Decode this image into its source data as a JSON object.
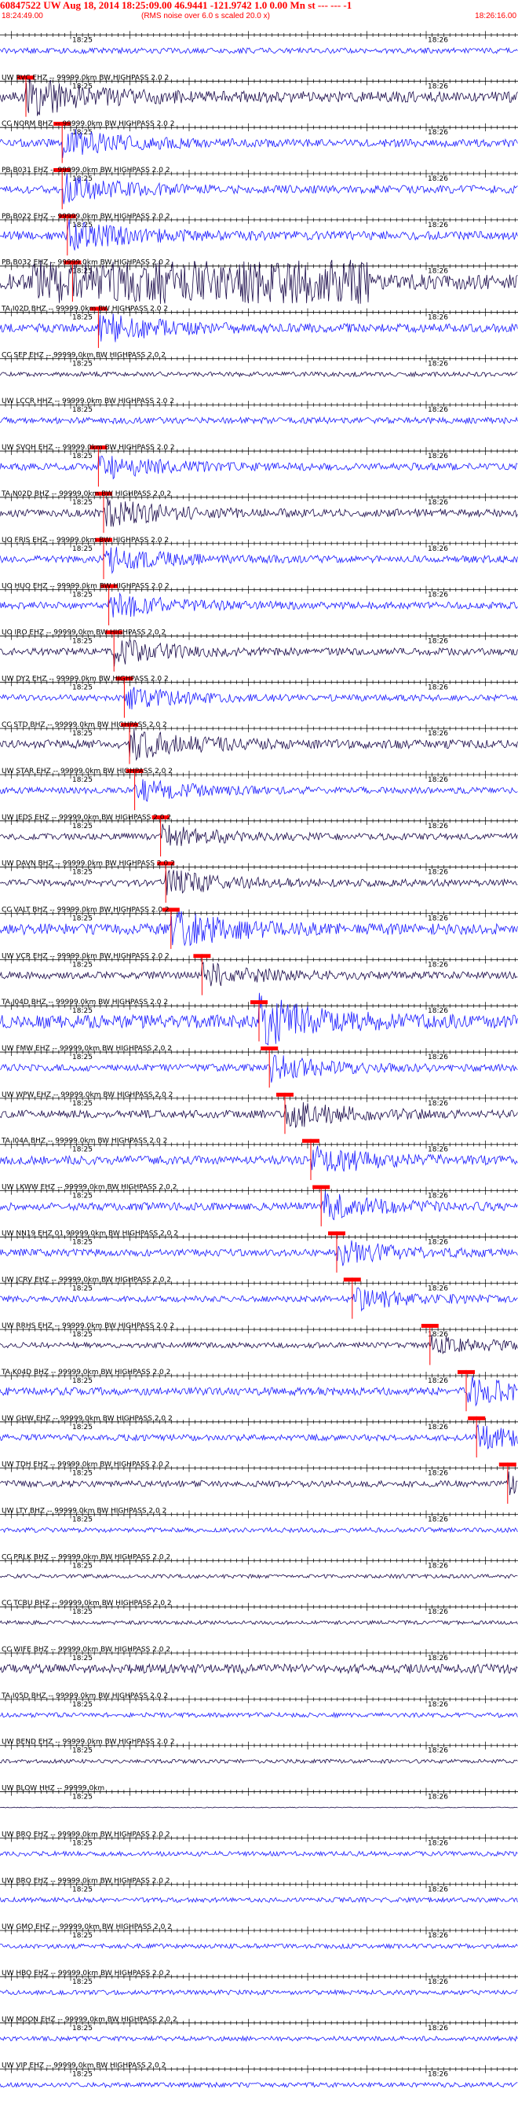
{
  "header": {
    "title": "60847522 UW Aug 18, 2014 18:25:09.00   46.9441 -121.9742  1.0 0.00 Mn st --- --- -1",
    "start_time": "18:24:49.00",
    "note": "(RMS noise over 6.0 s scaled 20.0 x)",
    "end_time": "18:26:16.00"
  },
  "colors": {
    "blue_trace": "#1a1aff",
    "dark_trace": "#1a0a4a",
    "pick_marker": "#ff0000",
    "grid_line": "#000000",
    "header_text": "#ff0000"
  },
  "chart_data": {
    "type": "line",
    "title": "60847522 UW Aug 18, 2014 18:25:09.00   46.9441 -121.9742  1.0 0.00 Mn st --- --- -1",
    "x_range": [
      "18:24:49.00",
      "18:26:16.00"
    ],
    "time_tick_labels": [
      "18:25",
      "18:26"
    ],
    "traces": [
      {
        "label": "",
        "color": "blue",
        "amplitude": 0.35,
        "pick": null
      },
      {
        "label": "UW RVC EHZ -- 99999.0km BW  HIGHPASS  2.0  2",
        "color": "dark",
        "amplitude": 0.7,
        "pick": 0.05
      },
      {
        "label": "CC NORM BHZ -- 99999.0km BW  HIGHPASS  2.0  2",
        "color": "blue",
        "amplitude": 0.5,
        "pick": 0.12
      },
      {
        "label": "PB B031 EHZ -- 99999.0km BW  HIGHPASS  2.0  2",
        "color": "blue",
        "amplitude": 0.5,
        "pick": 0.12
      },
      {
        "label": "PB B022 EHZ -- 99999.0km BW  HIGHPASS  2.0  2",
        "color": "blue",
        "amplitude": 0.55,
        "pick": 0.13
      },
      {
        "label": "PB B032 EHZ -- 99999.0km BW  HIGHPASS  2.0  2",
        "color": "dark",
        "amplitude": 1.0,
        "pick": 0.14
      },
      {
        "label": "TA I02D BHZ -- 99999.0km BW  HIGHPASS  2.0  2",
        "color": "blue",
        "amplitude": 0.55,
        "pick": 0.19
      },
      {
        "label": "CC SEP EHZ -- 99999.0km BW  HIGHPASS  2.0  2",
        "color": "dark",
        "amplitude": 0.3,
        "pick": null
      },
      {
        "label": "UW LCCR HHZ -- 99999.0km BW  HIGHPASS  2.0  2",
        "color": "blue",
        "amplitude": 0.4,
        "pick": null
      },
      {
        "label": "UW SVOH EHZ -- 99999.0km BW  HIGHPASS  2.0  2",
        "color": "blue",
        "amplitude": 0.45,
        "pick": 0.19
      },
      {
        "label": "TA N02D BHZ -- 99999.0km BW  HIGHPASS  2.0  2",
        "color": "dark",
        "amplitude": 0.5,
        "pick": 0.2
      },
      {
        "label": "UO FRIS EHZ -- 99999.0km BW  HIGHPASS  2.0  2",
        "color": "blue",
        "amplitude": 0.45,
        "pick": 0.2
      },
      {
        "label": "UO HUO EHZ -- 99999.0km BW  HIGHPASS  2.0  2",
        "color": "blue",
        "amplitude": 0.45,
        "pick": 0.21
      },
      {
        "label": "UO IRO EHZ -- 99999.0km BW  HIGHPASS  2.0  2",
        "color": "dark",
        "amplitude": 0.45,
        "pick": 0.22
      },
      {
        "label": "UW DY2 EHZ -- 99999.0km BW  HIGHPASS  2.0  2",
        "color": "blue",
        "amplitude": 0.4,
        "pick": 0.24
      },
      {
        "label": "CC STD BHZ -- 99999.0km BW  HIGHPASS  2.0  2",
        "color": "dark",
        "amplitude": 0.55,
        "pick": 0.25
      },
      {
        "label": "UW STAR EHZ -- 99999.0km BW  HIGHPASS  2.0  2",
        "color": "blue",
        "amplitude": 0.4,
        "pick": 0.26
      },
      {
        "label": "UW JEDS EHZ -- 99999.0km BW  HIGHPASS  2.0  2",
        "color": "dark",
        "amplitude": 0.4,
        "pick": 0.31
      },
      {
        "label": "UW DAVN BHZ -- 99999.0km BW  HIGHPASS  2.0  2",
        "color": "dark",
        "amplitude": 0.45,
        "pick": 0.32
      },
      {
        "label": "CC VALT BHZ -- 99999.0km BW  HIGHPASS  2.0  2",
        "color": "blue",
        "amplitude": 0.7,
        "pick": 0.33
      },
      {
        "label": "UW VCR EHZ -- 99999.0km BW  HIGHPASS  2.0  2",
        "color": "dark",
        "amplitude": 0.45,
        "pick": 0.39
      },
      {
        "label": "TA J04D BHZ -- 99999.0km BW  HIGHPASS  2.0  2",
        "color": "blue",
        "amplitude": 0.85,
        "pick": 0.5
      },
      {
        "label": "UW FMW EHZ -- 99999.0km BW  HIGHPASS  2.0  2",
        "color": "blue",
        "amplitude": 0.45,
        "pick": 0.52
      },
      {
        "label": "UW WPW EHZ -- 99999.0km BW  HIGHPASS  2.0  2",
        "color": "dark",
        "amplitude": 0.5,
        "pick": 0.55
      },
      {
        "label": "TA I04A BHZ -- 99999.0km BW  HIGHPASS  2.0  2",
        "color": "blue",
        "amplitude": 0.55,
        "pick": 0.6
      },
      {
        "label": "UW LKWW EHZ -- 99999.0km BW  HIGHPASS  2.0  2",
        "color": "blue",
        "amplitude": 0.5,
        "pick": 0.62
      },
      {
        "label": "UW NN19 EHZ 01 99999.0km BW  HIGHPASS  2.0  2",
        "color": "blue",
        "amplitude": 0.45,
        "pick": 0.65
      },
      {
        "label": "UW JCRV EHZ -- 99999.0km BW  HIGHPASS  2.0  2",
        "color": "blue",
        "amplitude": 0.4,
        "pick": 0.68
      },
      {
        "label": "UW RRHS EHZ -- 99999.0km BW  HIGHPASS  2.0  2",
        "color": "dark",
        "amplitude": 0.35,
        "pick": 0.83
      },
      {
        "label": "TA K04D BHZ -- 99999.0km BW  HIGHPASS  2.0  2",
        "color": "blue",
        "amplitude": 0.5,
        "pick": 0.9
      },
      {
        "label": "UW GHW EHZ -- 99999.0km BW  HIGHPASS  2.0  2",
        "color": "blue",
        "amplitude": 0.4,
        "pick": 0.92
      },
      {
        "label": "UW TDH EHZ -- 99999.0km BW  HIGHPASS  2.0  2",
        "color": "dark",
        "amplitude": 0.4,
        "pick": 0.98
      },
      {
        "label": "UW LTY BHZ -- 99999.0km BW  HIGHPASS  2.0  2",
        "color": "blue",
        "amplitude": 0.3,
        "pick": null
      },
      {
        "label": "CC PRLK BHZ -- 99999.0km BW  HIGHPASS  2.0  2",
        "color": "dark",
        "amplitude": 0.25,
        "pick": null
      },
      {
        "label": "CC TCBU BHZ -- 99999.0km BW  HIGHPASS  2.0  2",
        "color": "dark",
        "amplitude": 0.25,
        "pick": null
      },
      {
        "label": "CC WIFE BHZ -- 99999.0km BW  HIGHPASS  2.0  2",
        "color": "dark",
        "amplitude": 0.6,
        "pick": null
      },
      {
        "label": "TA I05D BHZ -- 99999.0km BW  HIGHPASS  2.0  2",
        "color": "blue",
        "amplitude": 0.3,
        "pick": null
      },
      {
        "label": "UW BEND EHZ -- 99999.0km BW  HIGHPASS  2.0  2",
        "color": "dark",
        "amplitude": 0.25,
        "pick": null
      },
      {
        "label": "UW BLOW HHZ -- 99999.0km",
        "color": "dark",
        "amplitude": 0.05,
        "pick": null
      },
      {
        "label": "UW BRO EHZ -- 99999.0km BW  HIGHPASS  2.0  2",
        "color": "blue",
        "amplitude": 0.3,
        "pick": null
      },
      {
        "label": "UW BRO EHZ -- 99999.0km BW  HIGHPASS  2.0  2",
        "color": "blue",
        "amplitude": 0.3,
        "pick": null
      },
      {
        "label": "UW GMO EHZ -- 99999.0km BW  HIGHPASS  2.0  2",
        "color": "blue",
        "amplitude": 0.3,
        "pick": null
      },
      {
        "label": "UW HBO EHZ -- 99999.0km BW  HIGHPASS  2.0  2",
        "color": "blue",
        "amplitude": 0.3,
        "pick": null
      },
      {
        "label": "UW MOON EHZ -- 99999.0km BW  HIGHPASS  2.0  2",
        "color": "blue",
        "amplitude": 0.3,
        "pick": null
      },
      {
        "label": "UW VIP EHZ -- 99999.0km BW  HIGHPASS  2.0  2",
        "color": "blue",
        "amplitude": 0.3,
        "pick": null
      }
    ]
  }
}
